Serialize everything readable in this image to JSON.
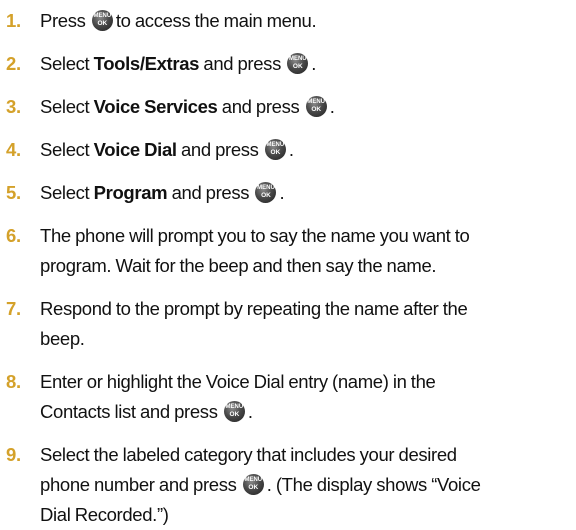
{
  "menu_key": {
    "top": "MENU",
    "bottom": "OK"
  },
  "steps": [
    {
      "number": "1.",
      "text1": "Press",
      "text2": "to access the main menu."
    },
    {
      "number": "2.",
      "text1": "Select",
      "bold": "Tools/Extras",
      "text2": "and press",
      "end": "."
    },
    {
      "number": "3.",
      "text1": "Select",
      "bold": "Voice Services",
      "text2": "and press",
      "end": "."
    },
    {
      "number": "4.",
      "text1": "Select",
      "bold": "Voice Dial",
      "text2": "and press",
      "end": "."
    },
    {
      "number": "5.",
      "text1": "Select",
      "bold": "Program",
      "text2": "and press",
      "end": "."
    },
    {
      "number": "6.",
      "line1": "The phone will prompt you to say the name you want to",
      "line2": "program. Wait for the beep and then say the name."
    },
    {
      "number": "7.",
      "line1": "Respond to the prompt by repeating the name after the",
      "line2": "beep."
    },
    {
      "number": "8.",
      "line1": "Enter or highlight the Voice Dial entry (name) in the",
      "line2": "Contacts list and press",
      "end": "."
    },
    {
      "number": "9.",
      "line1": "Select the labeled category that includes your desired",
      "line2a": "phone number and press",
      "line2b": ". (The display shows “Voice",
      "line3": "Dial Recorded.”)"
    }
  ]
}
